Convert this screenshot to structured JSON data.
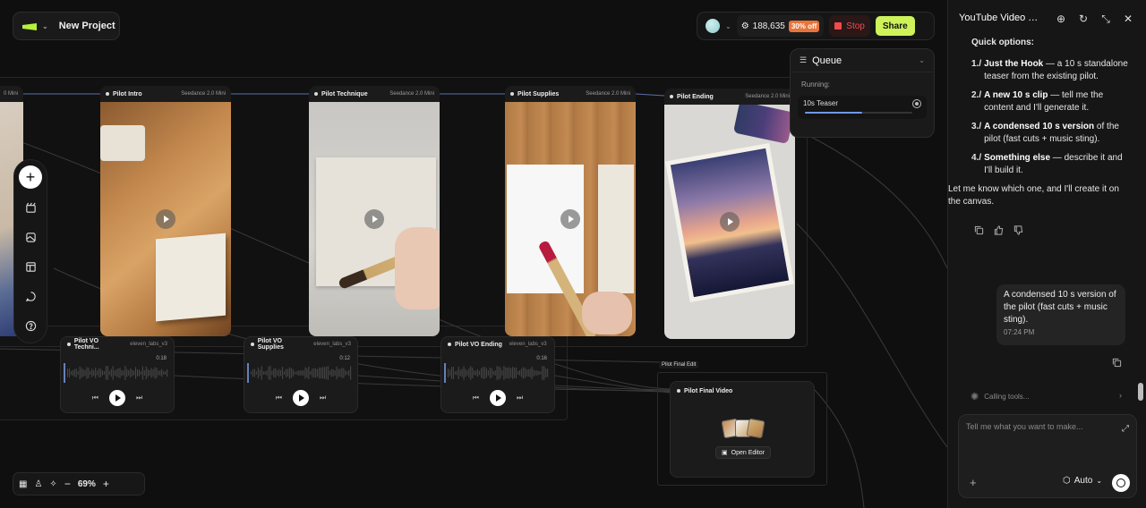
{
  "project": {
    "name": "New Project"
  },
  "toolbar": {
    "credits": "188,635",
    "discount": "30% off",
    "stop_label": "Stop",
    "share_label": "Share"
  },
  "queue": {
    "title": "Queue",
    "running_label": "Running:",
    "item_label": "10s Teaser",
    "progress": 0.53
  },
  "video_nodes": [
    {
      "title": "Pilot Intro",
      "model": "Seedance 2.0 Mini"
    },
    {
      "title": "Pilot Technique",
      "model": "Seedance 2.0 Mini"
    },
    {
      "title": "Pilot Supplies",
      "model": "Seedance 2.0 Mini"
    },
    {
      "title": "Pilot Ending",
      "model": "Seedance 2.0 Mini"
    }
  ],
  "partial_node": {
    "model": "0 Mini"
  },
  "audio_nodes": [
    {
      "title": "Pilot VO Techni...",
      "model": "eleven_labs_v3",
      "duration": "0:18"
    },
    {
      "title": "Pilot VO Supplies",
      "model": "eleven_labs_v3",
      "duration": "0:12"
    },
    {
      "title": "Pilot VO Ending",
      "model": "eleven_labs_v3",
      "duration": "0:16"
    }
  ],
  "final": {
    "group_label": "Pilot Final Edit",
    "node_title": "Pilot Final Video",
    "open_editor_label": "Open Editor"
  },
  "zoom": {
    "value": "69%"
  },
  "panel": {
    "title": "YouTube Video Scri...",
    "heading": "Quick options:",
    "options": [
      {
        "num": "1./",
        "bold": "Just the Hook",
        "rest": " — a 10 s standalone teaser from the existing pilot."
      },
      {
        "num": "2./",
        "bold": "A new 10 s clip",
        "rest": " — tell me the content and I'll generate it."
      },
      {
        "num": "3./",
        "bold": "A condensed 10 s version",
        "rest": " of the pilot (fast cuts + music sting)."
      },
      {
        "num": "4./",
        "bold": "Something else",
        "rest": " — describe it and I'll build it."
      }
    ],
    "closing": "Let me know which one, and I'll create it on the canvas.",
    "user_message": "A condensed 10 s version of the pilot (fast cuts + music sting).",
    "user_time": "07:24 PM",
    "calling_tools": "Calling tools...",
    "input_placeholder": "Tell me what you want to make...",
    "mode_label": "Auto"
  },
  "colors": {
    "accent": "#cdf25a",
    "stop": "#ef4b4b",
    "discount": "#e8743b",
    "progress": "#6f97e8"
  }
}
